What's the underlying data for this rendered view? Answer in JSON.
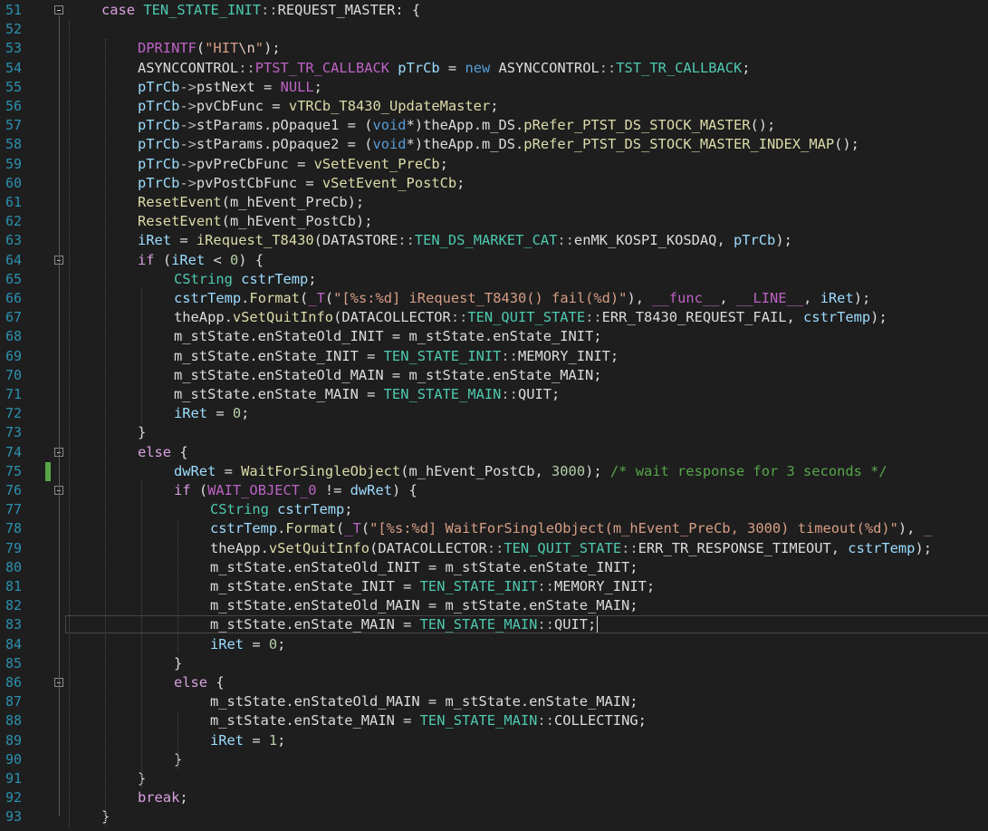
{
  "editor": {
    "language": "cpp",
    "theme_colors": {
      "background": "#1e1e1e",
      "line_number": "#2b91af",
      "keyword": "#569cd6",
      "control": "#d8a0df",
      "type": "#4ec9b0",
      "function": "#dcdcaa",
      "macro": "#bd63c5",
      "string": "#d69d85",
      "number": "#b5cea8",
      "comment": "#57a64a",
      "variable": "#9cdcfe"
    },
    "current_line": 83,
    "changed_lines": [
      75
    ],
    "fold_markers": [
      51,
      64,
      74,
      76,
      86
    ],
    "lines": [
      {
        "n": "51",
        "indent": 1,
        "tokens": [
          [
            "ctl",
            "case"
          ],
          [
            "txt",
            " "
          ],
          [
            "ty",
            "TEN_STATE_INIT"
          ],
          [
            "op",
            "::"
          ],
          [
            "txt",
            "REQUEST_MASTER: {"
          ]
        ]
      },
      {
        "n": "52",
        "indent": 0,
        "tokens": []
      },
      {
        "n": "53",
        "indent": 2,
        "tokens": [
          [
            "mac",
            "DPRINTF"
          ],
          [
            "txt",
            "("
          ],
          [
            "str",
            "\"HIT"
          ],
          [
            "esc",
            "\\n"
          ],
          [
            "str",
            "\""
          ],
          [
            "txt",
            ");"
          ]
        ]
      },
      {
        "n": "54",
        "indent": 2,
        "tokens": [
          [
            "txt",
            "ASYNCCONTROL"
          ],
          [
            "op",
            "::"
          ],
          [
            "mac",
            "PTST_TR_CALLBACK"
          ],
          [
            "txt",
            " "
          ],
          [
            "var",
            "pTrCb"
          ],
          [
            "txt",
            " = "
          ],
          [
            "kw",
            "new"
          ],
          [
            "txt",
            " ASYNCCONTROL"
          ],
          [
            "op",
            "::"
          ],
          [
            "ty",
            "TST_TR_CALLBACK"
          ],
          [
            "txt",
            ";"
          ]
        ]
      },
      {
        "n": "55",
        "indent": 2,
        "tokens": [
          [
            "var",
            "pTrCb"
          ],
          [
            "op",
            "->"
          ],
          [
            "txt",
            "pstNext = "
          ],
          [
            "mac",
            "NULL"
          ],
          [
            "txt",
            ";"
          ]
        ]
      },
      {
        "n": "56",
        "indent": 2,
        "tokens": [
          [
            "var",
            "pTrCb"
          ],
          [
            "op",
            "->"
          ],
          [
            "txt",
            "pvCbFunc = "
          ],
          [
            "fn",
            "vTRCb_T8430_UpdateMaster"
          ],
          [
            "txt",
            ";"
          ]
        ]
      },
      {
        "n": "57",
        "indent": 2,
        "tokens": [
          [
            "var",
            "pTrCb"
          ],
          [
            "op",
            "->"
          ],
          [
            "txt",
            "stParams.pOpaque1 = ("
          ],
          [
            "kw",
            "void"
          ],
          [
            "txt",
            "*)theApp.m_DS."
          ],
          [
            "fn",
            "pRefer_PTST_DS_STOCK_MASTER"
          ],
          [
            "txt",
            "();"
          ]
        ]
      },
      {
        "n": "58",
        "indent": 2,
        "tokens": [
          [
            "var",
            "pTrCb"
          ],
          [
            "op",
            "->"
          ],
          [
            "txt",
            "stParams.pOpaque2 = ("
          ],
          [
            "kw",
            "void"
          ],
          [
            "txt",
            "*)theApp.m_DS."
          ],
          [
            "fn",
            "pRefer_PTST_DS_STOCK_MASTER_INDEX_MAP"
          ],
          [
            "txt",
            "();"
          ]
        ]
      },
      {
        "n": "59",
        "indent": 2,
        "tokens": [
          [
            "var",
            "pTrCb"
          ],
          [
            "op",
            "->"
          ],
          [
            "txt",
            "pvPreCbFunc = "
          ],
          [
            "fn",
            "vSetEvent_PreCb"
          ],
          [
            "txt",
            ";"
          ]
        ]
      },
      {
        "n": "60",
        "indent": 2,
        "tokens": [
          [
            "var",
            "pTrCb"
          ],
          [
            "op",
            "->"
          ],
          [
            "txt",
            "pvPostCbFunc = "
          ],
          [
            "fn",
            "vSetEvent_PostCb"
          ],
          [
            "txt",
            ";"
          ]
        ]
      },
      {
        "n": "61",
        "indent": 2,
        "tokens": [
          [
            "fn",
            "ResetEvent"
          ],
          [
            "txt",
            "(m_hEvent_PreCb);"
          ]
        ]
      },
      {
        "n": "62",
        "indent": 2,
        "tokens": [
          [
            "fn",
            "ResetEvent"
          ],
          [
            "txt",
            "(m_hEvent_PostCb);"
          ]
        ]
      },
      {
        "n": "63",
        "indent": 2,
        "tokens": [
          [
            "var",
            "iRet"
          ],
          [
            "txt",
            " = "
          ],
          [
            "fn",
            "iRequest_T8430"
          ],
          [
            "txt",
            "(DATASTORE"
          ],
          [
            "op",
            "::"
          ],
          [
            "ty",
            "TEN_DS_MARKET_CAT"
          ],
          [
            "op",
            "::"
          ],
          [
            "txt",
            "enMK_KOSPI_KOSDAQ, "
          ],
          [
            "var",
            "pTrCb"
          ],
          [
            "txt",
            ");"
          ]
        ]
      },
      {
        "n": "64",
        "indent": 2,
        "tokens": [
          [
            "ctl",
            "if"
          ],
          [
            "txt",
            " ("
          ],
          [
            "var",
            "iRet"
          ],
          [
            "txt",
            " < "
          ],
          [
            "num",
            "0"
          ],
          [
            "txt",
            ") {"
          ]
        ]
      },
      {
        "n": "65",
        "indent": 3,
        "tokens": [
          [
            "ty",
            "CString"
          ],
          [
            "txt",
            " "
          ],
          [
            "var",
            "cstrTemp"
          ],
          [
            "txt",
            ";"
          ]
        ]
      },
      {
        "n": "66",
        "indent": 3,
        "tokens": [
          [
            "var",
            "cstrTemp"
          ],
          [
            "txt",
            "."
          ],
          [
            "fn",
            "Format"
          ],
          [
            "txt",
            "("
          ],
          [
            "mac",
            "_T"
          ],
          [
            "txt",
            "("
          ],
          [
            "str",
            "\"[%s:%d] iRequest_T8430() fail(%d)\""
          ],
          [
            "txt",
            "), "
          ],
          [
            "mac",
            "__func__"
          ],
          [
            "txt",
            ", "
          ],
          [
            "mac",
            "__LINE__"
          ],
          [
            "txt",
            ", "
          ],
          [
            "var",
            "iRet"
          ],
          [
            "txt",
            ");"
          ]
        ]
      },
      {
        "n": "67",
        "indent": 3,
        "tokens": [
          [
            "txt",
            "theApp."
          ],
          [
            "fn",
            "vSetQuitInfo"
          ],
          [
            "txt",
            "(DATACOLLECTOR"
          ],
          [
            "op",
            "::"
          ],
          [
            "ty",
            "TEN_QUIT_STATE"
          ],
          [
            "op",
            "::"
          ],
          [
            "txt",
            "ERR_T8430_REQUEST_FAIL, "
          ],
          [
            "var",
            "cstrTemp"
          ],
          [
            "txt",
            ");"
          ]
        ]
      },
      {
        "n": "68",
        "indent": 3,
        "tokens": [
          [
            "txt",
            "m_stState.enStateOld_INIT = m_stState.enState_INIT;"
          ]
        ]
      },
      {
        "n": "69",
        "indent": 3,
        "tokens": [
          [
            "txt",
            "m_stState.enState_INIT = "
          ],
          [
            "ty",
            "TEN_STATE_INIT"
          ],
          [
            "op",
            "::"
          ],
          [
            "txt",
            "MEMORY_INIT;"
          ]
        ]
      },
      {
        "n": "70",
        "indent": 3,
        "tokens": [
          [
            "txt",
            "m_stState.enStateOld_MAIN = m_stState.enState_MAIN;"
          ]
        ]
      },
      {
        "n": "71",
        "indent": 3,
        "tokens": [
          [
            "txt",
            "m_stState.enState_MAIN = "
          ],
          [
            "ty",
            "TEN_STATE_MAIN"
          ],
          [
            "op",
            "::"
          ],
          [
            "txt",
            "QUIT;"
          ]
        ]
      },
      {
        "n": "72",
        "indent": 3,
        "tokens": [
          [
            "var",
            "iRet"
          ],
          [
            "txt",
            " = "
          ],
          [
            "num",
            "0"
          ],
          [
            "txt",
            ";"
          ]
        ]
      },
      {
        "n": "73",
        "indent": 2,
        "tokens": [
          [
            "txt",
            "}"
          ]
        ]
      },
      {
        "n": "74",
        "indent": 2,
        "tokens": [
          [
            "ctl",
            "else"
          ],
          [
            "txt",
            " {"
          ]
        ]
      },
      {
        "n": "75",
        "indent": 3,
        "tokens": [
          [
            "var",
            "dwRet"
          ],
          [
            "txt",
            " = "
          ],
          [
            "fn",
            "WaitForSingleObject"
          ],
          [
            "txt",
            "(m_hEvent_PostCb, "
          ],
          [
            "num",
            "3000"
          ],
          [
            "txt",
            "); "
          ],
          [
            "cmt",
            "/* wait response for 3 seconds */"
          ]
        ]
      },
      {
        "n": "76",
        "indent": 3,
        "tokens": [
          [
            "ctl",
            "if"
          ],
          [
            "txt",
            " ("
          ],
          [
            "mac",
            "WAIT_OBJECT_0"
          ],
          [
            "txt",
            " != "
          ],
          [
            "var",
            "dwRet"
          ],
          [
            "txt",
            ") {"
          ]
        ]
      },
      {
        "n": "77",
        "indent": 4,
        "tokens": [
          [
            "ty",
            "CString"
          ],
          [
            "txt",
            " "
          ],
          [
            "var",
            "cstrTemp"
          ],
          [
            "txt",
            ";"
          ]
        ]
      },
      {
        "n": "78",
        "indent": 4,
        "tokens": [
          [
            "var",
            "cstrTemp"
          ],
          [
            "txt",
            "."
          ],
          [
            "fn",
            "Format"
          ],
          [
            "txt",
            "("
          ],
          [
            "mac",
            "_T"
          ],
          [
            "txt",
            "("
          ],
          [
            "str",
            "\"[%s:%d] WaitForSingleObject(m_hEvent_PreCb, 3000) timeout(%d)\""
          ],
          [
            "txt",
            "), "
          ],
          [
            "mac",
            "_"
          ]
        ]
      },
      {
        "n": "79",
        "indent": 4,
        "tokens": [
          [
            "txt",
            "theApp."
          ],
          [
            "fn",
            "vSetQuitInfo"
          ],
          [
            "txt",
            "(DATACOLLECTOR"
          ],
          [
            "op",
            "::"
          ],
          [
            "ty",
            "TEN_QUIT_STATE"
          ],
          [
            "op",
            "::"
          ],
          [
            "txt",
            "ERR_TR_RESPONSE_TIMEOUT, "
          ],
          [
            "var",
            "cstrTemp"
          ],
          [
            "txt",
            ");"
          ]
        ]
      },
      {
        "n": "80",
        "indent": 4,
        "tokens": [
          [
            "txt",
            "m_stState.enStateOld_INIT = m_stState.enState_INIT;"
          ]
        ]
      },
      {
        "n": "81",
        "indent": 4,
        "tokens": [
          [
            "txt",
            "m_stState.enState_INIT = "
          ],
          [
            "ty",
            "TEN_STATE_INIT"
          ],
          [
            "op",
            "::"
          ],
          [
            "txt",
            "MEMORY_INIT;"
          ]
        ]
      },
      {
        "n": "82",
        "indent": 4,
        "tokens": [
          [
            "txt",
            "m_stState.enStateOld_MAIN = m_stState.enState_MAIN;"
          ]
        ]
      },
      {
        "n": "83",
        "indent": 4,
        "tokens": [
          [
            "txt",
            "m_stState.enState_MAIN = "
          ],
          [
            "ty",
            "TEN_STATE_MAIN"
          ],
          [
            "op",
            "::"
          ],
          [
            "txt",
            "QUIT;"
          ]
        ]
      },
      {
        "n": "84",
        "indent": 4,
        "tokens": [
          [
            "var",
            "iRet"
          ],
          [
            "txt",
            " = "
          ],
          [
            "num",
            "0"
          ],
          [
            "txt",
            ";"
          ]
        ]
      },
      {
        "n": "85",
        "indent": 3,
        "tokens": [
          [
            "txt",
            "}"
          ]
        ]
      },
      {
        "n": "86",
        "indent": 3,
        "tokens": [
          [
            "ctl",
            "else"
          ],
          [
            "txt",
            " {"
          ]
        ]
      },
      {
        "n": "87",
        "indent": 4,
        "tokens": [
          [
            "txt",
            "m_stState.enStateOld_MAIN = m_stState.enState_MAIN;"
          ]
        ]
      },
      {
        "n": "88",
        "indent": 4,
        "tokens": [
          [
            "txt",
            "m_stState.enState_MAIN = "
          ],
          [
            "ty",
            "TEN_STATE_MAIN"
          ],
          [
            "op",
            "::"
          ],
          [
            "txt",
            "COLLECTING;"
          ]
        ]
      },
      {
        "n": "89",
        "indent": 4,
        "tokens": [
          [
            "var",
            "iRet"
          ],
          [
            "txt",
            " = "
          ],
          [
            "num",
            "1"
          ],
          [
            "txt",
            ";"
          ]
        ]
      },
      {
        "n": "90",
        "indent": 3,
        "tokens": [
          [
            "txt",
            "}"
          ]
        ]
      },
      {
        "n": "91",
        "indent": 2,
        "tokens": [
          [
            "txt",
            "}"
          ]
        ]
      },
      {
        "n": "92",
        "indent": 2,
        "tokens": [
          [
            "ctl",
            "break"
          ],
          [
            "txt",
            ";"
          ]
        ]
      },
      {
        "n": "93",
        "indent": 1,
        "tokens": [
          [
            "txt",
            "}"
          ]
        ]
      }
    ]
  }
}
